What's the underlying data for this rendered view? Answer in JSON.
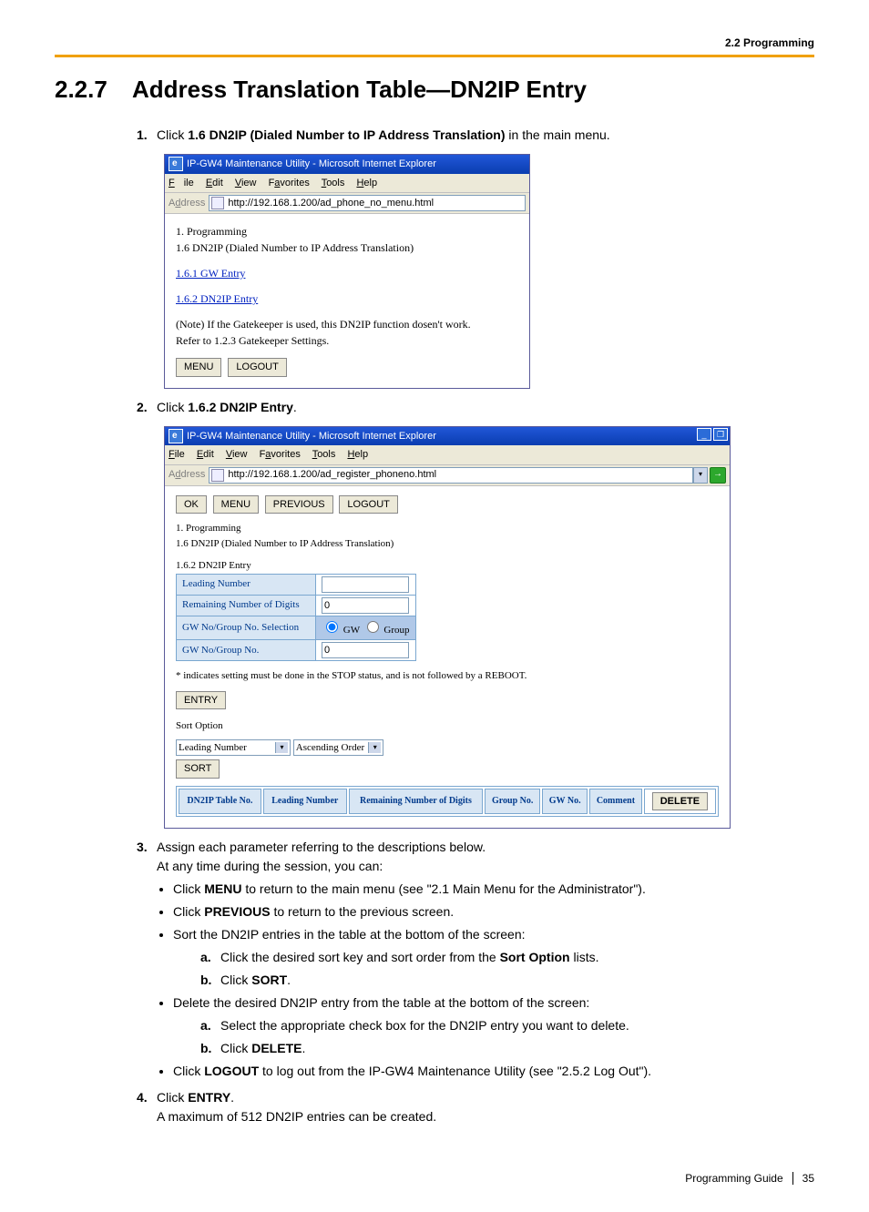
{
  "header": {
    "breadcrumb": "2.2 Programming"
  },
  "title": {
    "num": "2.2.7",
    "text": "Address Translation Table—DN2IP Entry"
  },
  "steps": {
    "s1": {
      "num": "1.",
      "pre": "Click ",
      "bold": "1.6 DN2IP (Dialed Number to IP Address Translation)",
      "post": " in the main menu."
    },
    "s2": {
      "num": "2.",
      "pre": "Click ",
      "bold": "1.6.2 DN2IP Entry",
      "post": "."
    },
    "s3": {
      "num": "3.",
      "line1": "Assign each parameter referring to the descriptions below.",
      "line2": "At any time during the session, you can:",
      "b1_pre": "Click ",
      "b1_bold": "MENU",
      "b1_post": " to return to the main menu (see \"2.1 Main Menu for the Administrator\").",
      "b2_pre": "Click ",
      "b2_bold": "PREVIOUS",
      "b2_post": " to return to the previous screen.",
      "b3": "Sort the DN2IP entries in the table at the bottom of the screen:",
      "b3a_pre": "Click the desired sort key and sort order from the ",
      "b3a_bold": "Sort Option",
      "b3a_post": " lists.",
      "b3b_pre": "Click ",
      "b3b_bold": "SORT",
      "b3b_post": ".",
      "b4": "Delete the desired DN2IP entry from the table at the bottom of the screen:",
      "b4a": "Select the appropriate check box for the DN2IP entry you want to delete.",
      "b4b_pre": "Click ",
      "b4b_bold": "DELETE",
      "b4b_post": ".",
      "b5_pre": "Click ",
      "b5_bold": "LOGOUT",
      "b5_post": " to log out from the IP-GW4 Maintenance Utility (see \"2.5.2 Log Out\")."
    },
    "s4": {
      "num": "4.",
      "pre": "Click ",
      "bold": "ENTRY",
      "post": ".",
      "line2": "A maximum of 512 DN2IP entries can be created."
    },
    "letters": {
      "a": "a.",
      "b": "b."
    }
  },
  "ie_menu": {
    "file": "File",
    "edit": "Edit",
    "view": "View",
    "fav": "Favorites",
    "tools": "Tools",
    "help": "Help",
    "address": "Address"
  },
  "shot1": {
    "title": "IP-GW4 Maintenance Utility - Microsoft Internet Explorer",
    "url": "http://192.168.1.200/ad_phone_no_menu.html",
    "l1": "1. Programming",
    "l2": "1.6 DN2IP (Dialed Number to IP Address Translation)",
    "link1": "1.6.1 GW Entry",
    "link2": "1.6.2 DN2IP Entry",
    "note1": "(Note) If the Gatekeeper is used, this DN2IP function dosen't work.",
    "note2": "Refer to 1.2.3 Gatekeeper Settings.",
    "btn_menu": "MENU",
    "btn_logout": "LOGOUT"
  },
  "shot2": {
    "title": "IP-GW4 Maintenance Utility - Microsoft Internet Explorer",
    "url": "http://192.168.1.200/ad_register_phoneno.html",
    "btn_ok": "OK",
    "btn_menu": "MENU",
    "btn_prev": "PREVIOUS",
    "btn_logout": "LOGOUT",
    "l1": "1. Programming",
    "l2": "1.6 DN2IP (Dialed Number to IP Address Translation)",
    "l3": "1.6.2 DN2IP Entry",
    "row_leading": "Leading Number",
    "row_remaining": "Remaining Number of Digits",
    "row_sel": "GW No/Group No. Selection",
    "row_gwno": "GW No/Group No.",
    "val_remaining": "0",
    "val_gwno": "0",
    "radio_gw": "GW",
    "radio_group": "Group",
    "note": "* indicates setting must be done in the STOP status, and is not followed by a REBOOT.",
    "btn_entry": "ENTRY",
    "sort_heading": "Sort Option",
    "sort_key": "Leading Number",
    "sort_order": "Ascending Order",
    "btn_sort": "SORT",
    "tbl": {
      "c1": "DN2IP Table No.",
      "c2": "Leading Number",
      "c3": "Remaining Number of Digits",
      "c4": "Group No.",
      "c5": "GW No.",
      "c6": "Comment",
      "c7": "DELETE"
    }
  },
  "footer": {
    "guide": "Programming Guide",
    "page": "35"
  }
}
